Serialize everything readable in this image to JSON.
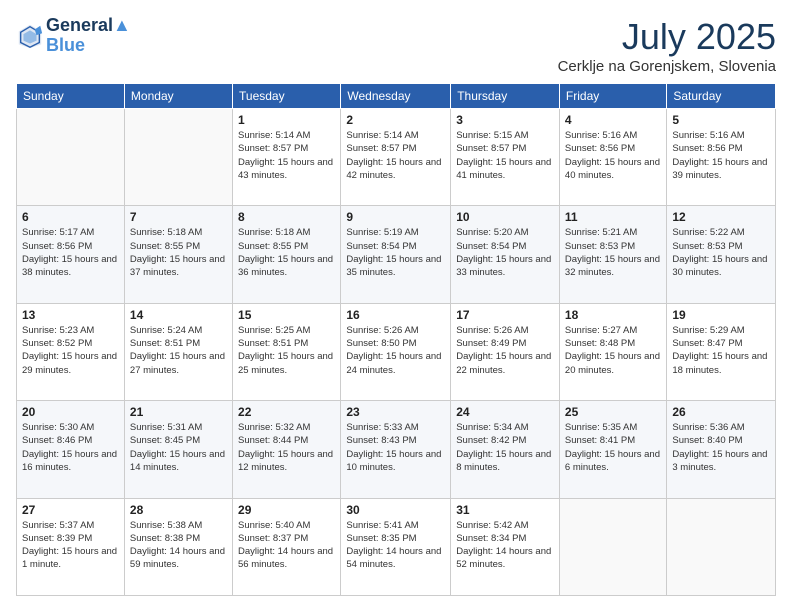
{
  "header": {
    "logo_line1": "General",
    "logo_line2": "Blue",
    "month": "July 2025",
    "location": "Cerklje na Gorenjskem, Slovenia"
  },
  "weekdays": [
    "Sunday",
    "Monday",
    "Tuesday",
    "Wednesday",
    "Thursday",
    "Friday",
    "Saturday"
  ],
  "weeks": [
    [
      {
        "day": "",
        "info": ""
      },
      {
        "day": "",
        "info": ""
      },
      {
        "day": "1",
        "info": "Sunrise: 5:14 AM\nSunset: 8:57 PM\nDaylight: 15 hours and 43 minutes."
      },
      {
        "day": "2",
        "info": "Sunrise: 5:14 AM\nSunset: 8:57 PM\nDaylight: 15 hours and 42 minutes."
      },
      {
        "day": "3",
        "info": "Sunrise: 5:15 AM\nSunset: 8:57 PM\nDaylight: 15 hours and 41 minutes."
      },
      {
        "day": "4",
        "info": "Sunrise: 5:16 AM\nSunset: 8:56 PM\nDaylight: 15 hours and 40 minutes."
      },
      {
        "day": "5",
        "info": "Sunrise: 5:16 AM\nSunset: 8:56 PM\nDaylight: 15 hours and 39 minutes."
      }
    ],
    [
      {
        "day": "6",
        "info": "Sunrise: 5:17 AM\nSunset: 8:56 PM\nDaylight: 15 hours and 38 minutes."
      },
      {
        "day": "7",
        "info": "Sunrise: 5:18 AM\nSunset: 8:55 PM\nDaylight: 15 hours and 37 minutes."
      },
      {
        "day": "8",
        "info": "Sunrise: 5:18 AM\nSunset: 8:55 PM\nDaylight: 15 hours and 36 minutes."
      },
      {
        "day": "9",
        "info": "Sunrise: 5:19 AM\nSunset: 8:54 PM\nDaylight: 15 hours and 35 minutes."
      },
      {
        "day": "10",
        "info": "Sunrise: 5:20 AM\nSunset: 8:54 PM\nDaylight: 15 hours and 33 minutes."
      },
      {
        "day": "11",
        "info": "Sunrise: 5:21 AM\nSunset: 8:53 PM\nDaylight: 15 hours and 32 minutes."
      },
      {
        "day": "12",
        "info": "Sunrise: 5:22 AM\nSunset: 8:53 PM\nDaylight: 15 hours and 30 minutes."
      }
    ],
    [
      {
        "day": "13",
        "info": "Sunrise: 5:23 AM\nSunset: 8:52 PM\nDaylight: 15 hours and 29 minutes."
      },
      {
        "day": "14",
        "info": "Sunrise: 5:24 AM\nSunset: 8:51 PM\nDaylight: 15 hours and 27 minutes."
      },
      {
        "day": "15",
        "info": "Sunrise: 5:25 AM\nSunset: 8:51 PM\nDaylight: 15 hours and 25 minutes."
      },
      {
        "day": "16",
        "info": "Sunrise: 5:26 AM\nSunset: 8:50 PM\nDaylight: 15 hours and 24 minutes."
      },
      {
        "day": "17",
        "info": "Sunrise: 5:26 AM\nSunset: 8:49 PM\nDaylight: 15 hours and 22 minutes."
      },
      {
        "day": "18",
        "info": "Sunrise: 5:27 AM\nSunset: 8:48 PM\nDaylight: 15 hours and 20 minutes."
      },
      {
        "day": "19",
        "info": "Sunrise: 5:29 AM\nSunset: 8:47 PM\nDaylight: 15 hours and 18 minutes."
      }
    ],
    [
      {
        "day": "20",
        "info": "Sunrise: 5:30 AM\nSunset: 8:46 PM\nDaylight: 15 hours and 16 minutes."
      },
      {
        "day": "21",
        "info": "Sunrise: 5:31 AM\nSunset: 8:45 PM\nDaylight: 15 hours and 14 minutes."
      },
      {
        "day": "22",
        "info": "Sunrise: 5:32 AM\nSunset: 8:44 PM\nDaylight: 15 hours and 12 minutes."
      },
      {
        "day": "23",
        "info": "Sunrise: 5:33 AM\nSunset: 8:43 PM\nDaylight: 15 hours and 10 minutes."
      },
      {
        "day": "24",
        "info": "Sunrise: 5:34 AM\nSunset: 8:42 PM\nDaylight: 15 hours and 8 minutes."
      },
      {
        "day": "25",
        "info": "Sunrise: 5:35 AM\nSunset: 8:41 PM\nDaylight: 15 hours and 6 minutes."
      },
      {
        "day": "26",
        "info": "Sunrise: 5:36 AM\nSunset: 8:40 PM\nDaylight: 15 hours and 3 minutes."
      }
    ],
    [
      {
        "day": "27",
        "info": "Sunrise: 5:37 AM\nSunset: 8:39 PM\nDaylight: 15 hours and 1 minute."
      },
      {
        "day": "28",
        "info": "Sunrise: 5:38 AM\nSunset: 8:38 PM\nDaylight: 14 hours and 59 minutes."
      },
      {
        "day": "29",
        "info": "Sunrise: 5:40 AM\nSunset: 8:37 PM\nDaylight: 14 hours and 56 minutes."
      },
      {
        "day": "30",
        "info": "Sunrise: 5:41 AM\nSunset: 8:35 PM\nDaylight: 14 hours and 54 minutes."
      },
      {
        "day": "31",
        "info": "Sunrise: 5:42 AM\nSunset: 8:34 PM\nDaylight: 14 hours and 52 minutes."
      },
      {
        "day": "",
        "info": ""
      },
      {
        "day": "",
        "info": ""
      }
    ]
  ]
}
